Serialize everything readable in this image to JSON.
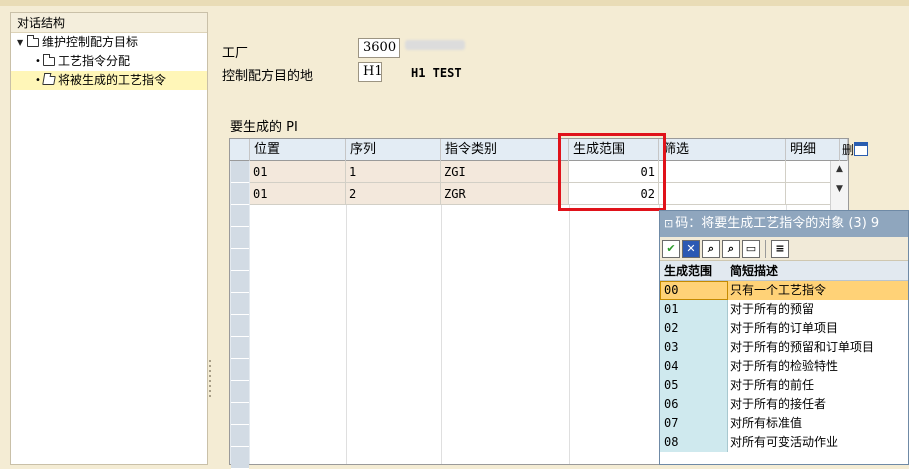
{
  "tree": {
    "title": "对话结构",
    "items": [
      {
        "label": "维护控制配方目标"
      },
      {
        "label": "工艺指令分配"
      },
      {
        "label": "将被生成的工艺指令"
      }
    ]
  },
  "header": {
    "plant_label": "工厂",
    "plant_value": "3600",
    "destination_label": "控制配方目的地",
    "destination_value": "H1",
    "destination_text": "H1 TEST"
  },
  "table": {
    "title": "要生成的 PI",
    "columns": [
      "位置",
      "序列",
      "指令类别",
      "生成范围",
      "筛选",
      "明细",
      "删"
    ],
    "rows": [
      {
        "pos": "01",
        "seq": "1",
        "cat": "ZGI",
        "scope": "01"
      },
      {
        "pos": "01",
        "seq": "2",
        "cat": "ZGR",
        "scope": "02"
      }
    ]
  },
  "popup": {
    "title": "码：将要生成工艺指令的对象 (3)   9",
    "headers": [
      "生成范围",
      "简短描述"
    ],
    "rows": [
      {
        "code": "00",
        "desc": "只有一个工艺指令"
      },
      {
        "code": "01",
        "desc": "对于所有的预留"
      },
      {
        "code": "02",
        "desc": "对于所有的订单项目"
      },
      {
        "code": "03",
        "desc": "对于所有的预留和订单项目"
      },
      {
        "code": "04",
        "desc": "对于所有的检验特性"
      },
      {
        "code": "05",
        "desc": "对于所有的前任"
      },
      {
        "code": "06",
        "desc": "对于所有的接任者"
      },
      {
        "code": "07",
        "desc": "对所有标准值"
      },
      {
        "code": "08",
        "desc": "对所有可变活动作业"
      }
    ]
  },
  "colors": {
    "highlight_box": "#e0121a",
    "selected_row": "#ffd277",
    "popup_title_bg": "#8fa6be"
  }
}
